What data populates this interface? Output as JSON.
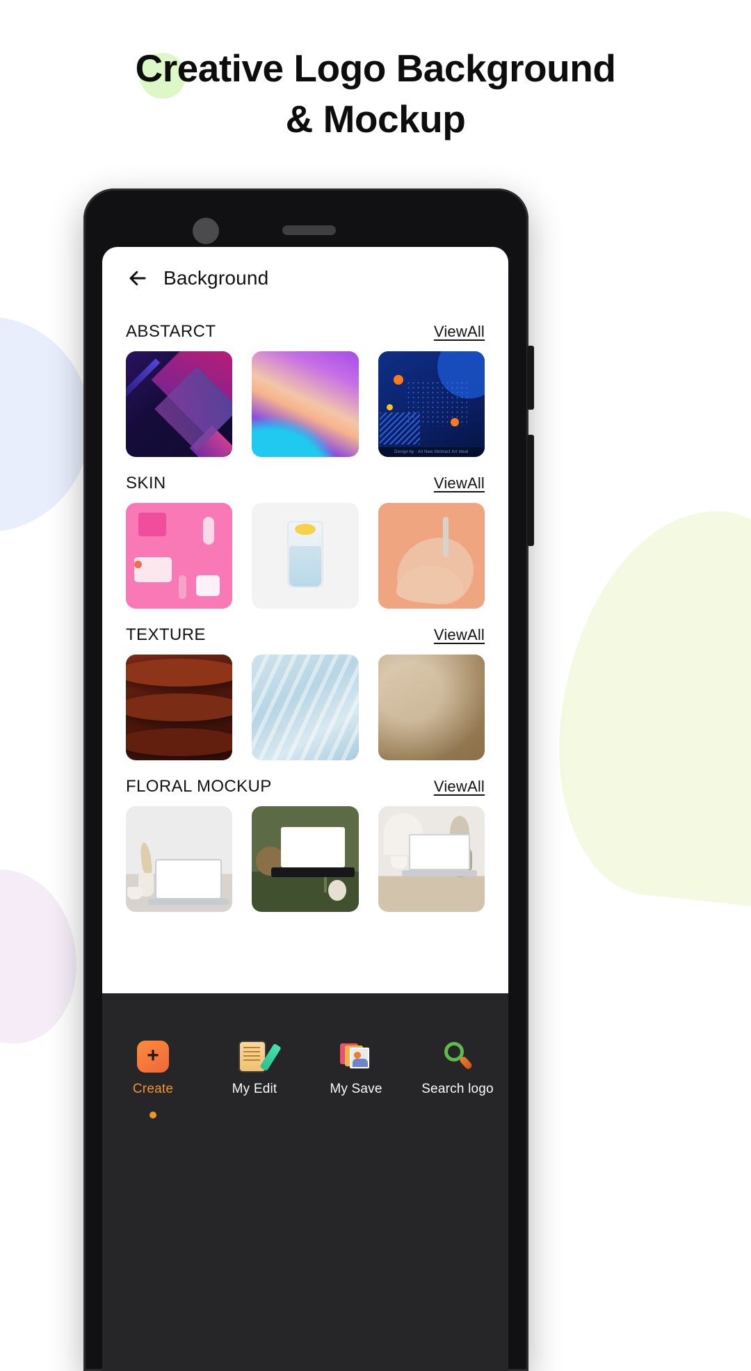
{
  "promo": {
    "headline_line1": "Creative Logo Background",
    "headline_line2": "& Mockup",
    "accent_circle_color": "#ddf7c6"
  },
  "device": {
    "camera_icon": "front-camera",
    "speaker_icon": "earpiece-speaker"
  },
  "appbar": {
    "back_icon": "back-arrow-icon",
    "title": "Background"
  },
  "sections": [
    {
      "title": "ABSTARCT",
      "view_all": "ViewAll",
      "thumbs": [
        {
          "name": "abstract-geometric-purple",
          "credit": ""
        },
        {
          "name": "abstract-gradient-wave",
          "credit": ""
        },
        {
          "name": "abstract-blue-dots",
          "credit": "Design by : All New Abstract Art Ideal"
        }
      ]
    },
    {
      "title": "SKIN",
      "view_all": "ViewAll",
      "thumbs": [
        {
          "name": "pink-cosmetics-flatlay",
          "credit": ""
        },
        {
          "name": "lemon-water-glass",
          "credit": ""
        },
        {
          "name": "serum-dropper-hand",
          "credit": ""
        }
      ]
    },
    {
      "title": "TEXTURE",
      "view_all": "ViewAll",
      "thumbs": [
        {
          "name": "dark-wood-grain",
          "credit": ""
        },
        {
          "name": "light-blue-fabric",
          "credit": ""
        },
        {
          "name": "beige-parchment",
          "credit": ""
        }
      ]
    },
    {
      "title": "FLORAL MOCKUP",
      "view_all": "ViewAll",
      "thumbs": [
        {
          "name": "laptop-white-desk",
          "credit": ""
        },
        {
          "name": "laptop-green-backdrop",
          "credit": ""
        },
        {
          "name": "laptop-beige-shelf",
          "credit": ""
        }
      ]
    }
  ],
  "bottom_nav": {
    "active_index": 0,
    "active_color": "#f0932b",
    "items": [
      {
        "label": "Create",
        "icon": "plus-square-icon"
      },
      {
        "label": "My Edit",
        "icon": "edit-pencil-icon"
      },
      {
        "label": "My Save",
        "icon": "saved-images-icon"
      },
      {
        "label": "Search logo",
        "icon": "magnifier-icon"
      }
    ]
  }
}
